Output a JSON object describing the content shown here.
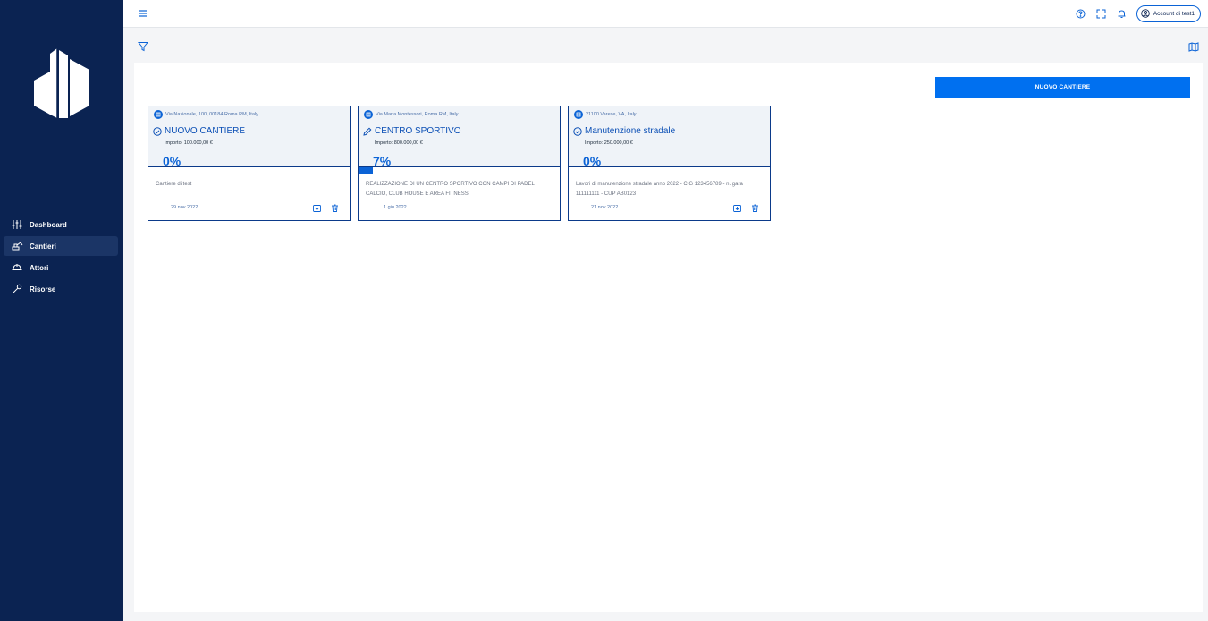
{
  "sidebar": {
    "items": [
      {
        "label": "Dashboard",
        "icon": "sliders-icon"
      },
      {
        "label": "Cantieri",
        "icon": "excavator-icon"
      },
      {
        "label": "Attori",
        "icon": "hardhat-icon"
      },
      {
        "label": "Risorse",
        "icon": "wrench-icon"
      }
    ],
    "active": "Cantieri"
  },
  "topbar": {
    "account_label": "Account di test1"
  },
  "main": {
    "new_button_label": "NUOVO CANTIERE",
    "cards": [
      {
        "address": "Via Nazionale, 100, 00184 Roma RM, Italy",
        "title": "NUOVO CANTIERE",
        "importo": "Importo: 100.000,00 €",
        "percent_label": "0%",
        "progress": 0,
        "status_icon": "check-circle-icon",
        "description": "Cantiere di test",
        "date": "29 nov 2022"
      },
      {
        "address": "Via Maria Montessori, Roma RM, Italy",
        "title": "CENTRO SPORTIVO",
        "importo": "Importo: 800.000,00 €",
        "percent_label": "7%",
        "progress": 0.07,
        "status_icon": "pencil-icon",
        "description": "REALIZZAZIONE DI UN CENTRO SPORTIVO CON CAMPI DI PADEL CALCIO, CLUB HOUSE E AREA FITNESS",
        "date": "1 giu 2022"
      },
      {
        "address": "21100 Varese, VA, Italy",
        "title": "Manutenzione stradale",
        "importo": "Importo: 250.000,00 €",
        "percent_label": "0%",
        "progress": 0,
        "status_icon": "check-circle-icon",
        "description": "Lavori di manutenzione stradale anno 2022 - CIG 123456789 - n. gara 111111111 - CUP AB0123",
        "date": "21 nov 2022"
      }
    ]
  },
  "colors": {
    "sidebar_bg": "#0b2352",
    "accent": "#0070f0",
    "card_border": "#0b3a8a"
  }
}
